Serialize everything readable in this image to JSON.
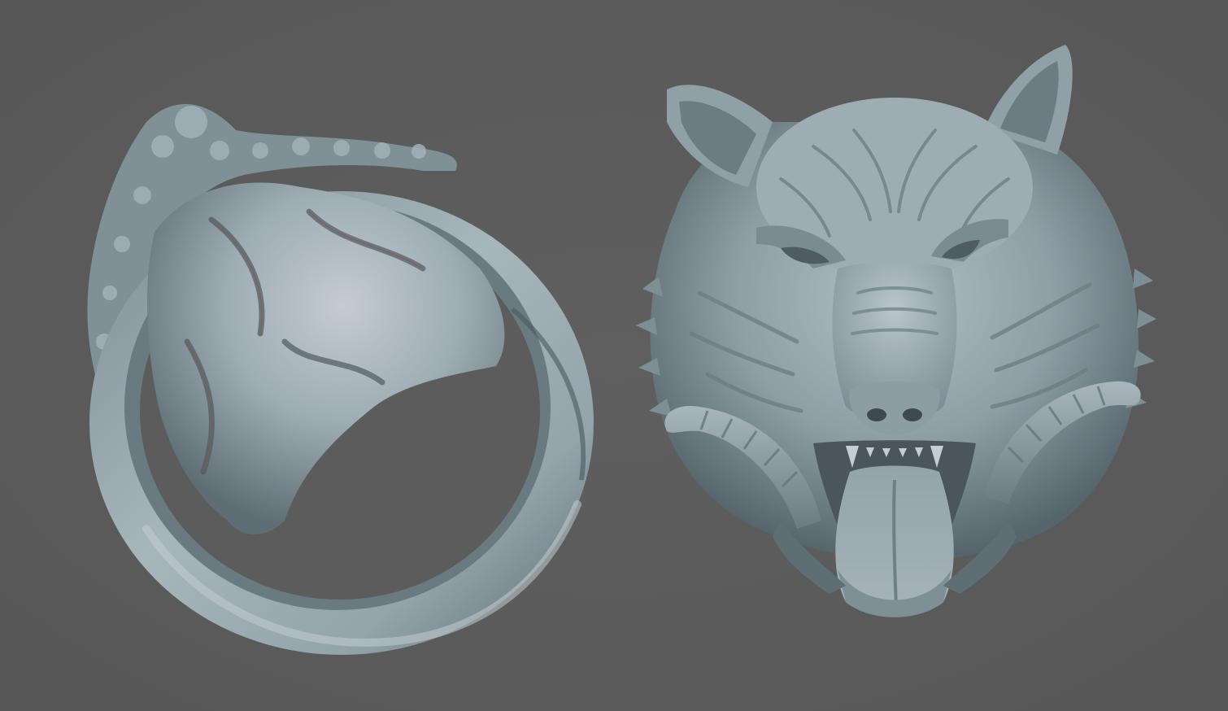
{
  "scene": {
    "background_color": "#5c5c5c",
    "material_light": "#a9b7bc",
    "material_mid": "#8b9ca3",
    "material_shadow": "#3f4a50",
    "cavity_tint": "#8a5a52",
    "objects": [
      {
        "name": "ring-band-view",
        "icon": "ring-icon"
      },
      {
        "name": "wolf-head-view",
        "icon": "wolf-icon"
      }
    ]
  }
}
